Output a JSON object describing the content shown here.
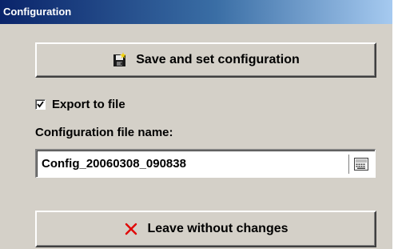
{
  "window": {
    "title": "Configuration"
  },
  "buttons": {
    "save_label": "Save and set configuration",
    "save_icon": "floppy-disk-icon",
    "leave_label": "Leave without changes",
    "leave_icon": "red-x-icon"
  },
  "export": {
    "label": "Export to file",
    "checked": true
  },
  "filename": {
    "label": "Configuration file name:",
    "value": "Config_20060308_090838",
    "icon": "keyboard-icon"
  },
  "colors": {
    "title_bar_start": "#0a246a",
    "title_bar_end": "#a6caf0",
    "dialog_background": "#d4d0c8",
    "cancel_icon": "#e00000"
  }
}
